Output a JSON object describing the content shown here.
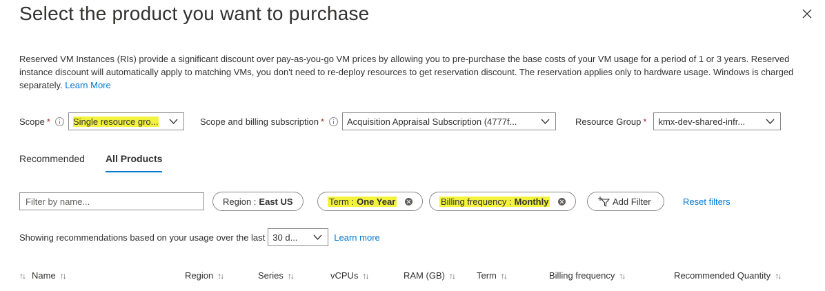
{
  "header": {
    "title": "Select the product you want to purchase"
  },
  "description": {
    "text": "Reserved VM Instances (RIs) provide a significant discount over pay-as-you-go VM prices by allowing you to pre-purchase the base costs of your VM usage for a period of 1 or 3 years. Reserved instance discount will automatically apply to matching VMs, you don't need to re-deploy resources to get reservation discount. The reservation applies only to hardware usage. Windows is charged separately.",
    "learn_more": "Learn More"
  },
  "scope_row": {
    "scope_label": "Scope",
    "scope_value": "Single resource gro...",
    "subscription_label": "Scope and billing subscription",
    "subscription_value": "Acquisition Appraisal Subscription (4777f...",
    "resource_group_label": "Resource Group",
    "resource_group_value": "kmx-dev-shared-infr...",
    "required_mark": "*"
  },
  "tabs": [
    {
      "label": "Recommended",
      "active": false
    },
    {
      "label": "All Products",
      "active": true
    }
  ],
  "filters": {
    "search_placeholder": "Filter by name...",
    "region_key": "Region :",
    "region_value": "East US",
    "term_key": "Term :",
    "term_value": "One Year",
    "billing_key": "Billing frequency :",
    "billing_value": "Monthly",
    "add_filter": "Add Filter",
    "reset": "Reset filters"
  },
  "usage": {
    "text": "Showing recommendations based on your usage over the last",
    "period_value": "30 d...",
    "learn_more": "Learn more"
  },
  "table": {
    "columns": [
      "Name",
      "Region",
      "Series",
      "vCPUs",
      "RAM (GB)",
      "Term",
      "Billing frequency",
      "Recommended Quantity"
    ]
  },
  "colors": {
    "accent": "#0078d4",
    "highlight": "#f3f33e",
    "required": "#a4262c"
  }
}
